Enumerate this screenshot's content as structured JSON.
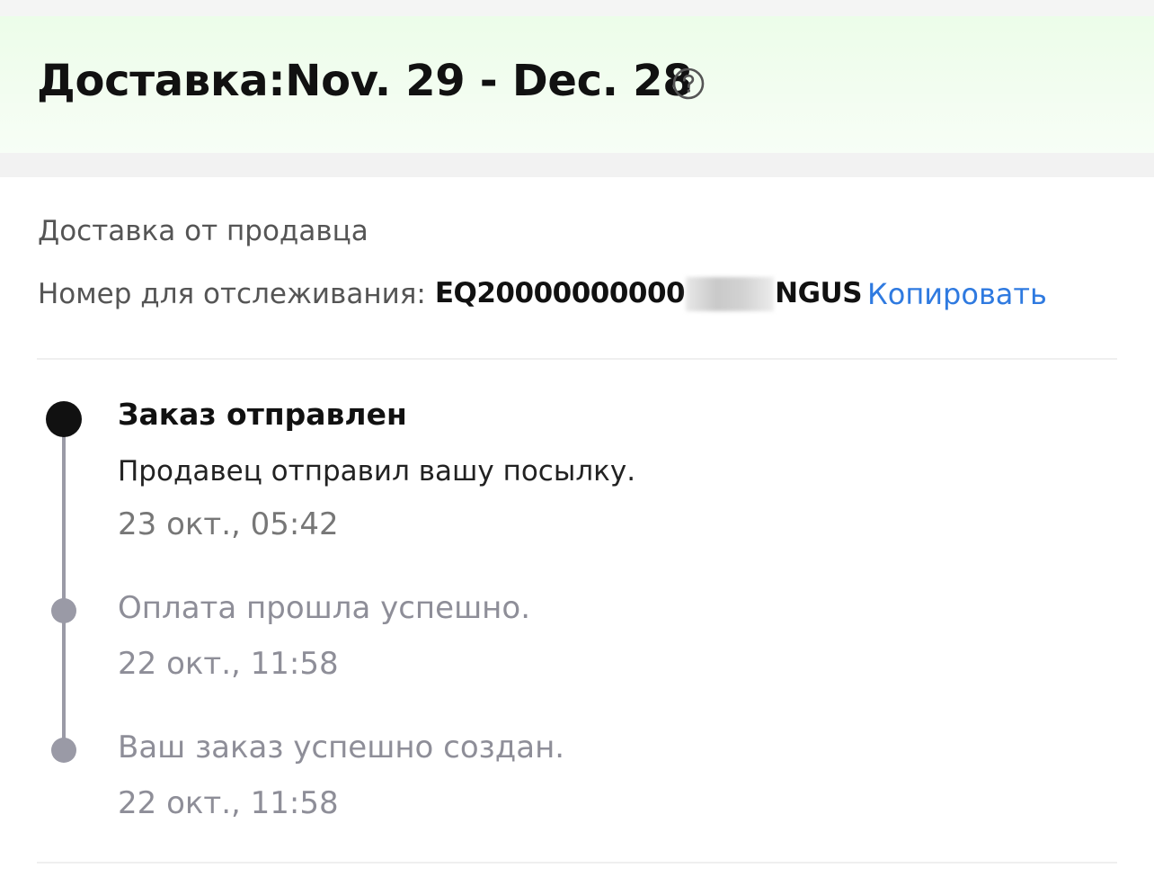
{
  "header": {
    "delivery_title": "Доставка:Nov. 29 - Dec. 28",
    "help_icon": "question-circle-icon"
  },
  "shipping": {
    "seller_label": "Доставка от продавца",
    "tracking_label": "Номер для отслеживания:",
    "tracking_prefix": "EQ20000000000",
    "tracking_suffix": "NGUS",
    "copy_label": "Копировать"
  },
  "timeline": {
    "events": [
      {
        "title": "Заказ отправлен",
        "text": "Продавец отправил вашу посылку.",
        "time": "23 окт., 05:42",
        "active": true
      },
      {
        "text": "Оплата прошла успешно.",
        "time": "22 окт., 11:58",
        "active": false
      },
      {
        "text": "Ваш заказ успешно создан.",
        "time": "22 окт., 11:58",
        "active": false
      }
    ]
  },
  "colors": {
    "accent_link": "#2f7ae0",
    "header_bg": "#ecfde9",
    "timeline_grey": "#9a9aa6",
    "active_dot": "#111111"
  }
}
